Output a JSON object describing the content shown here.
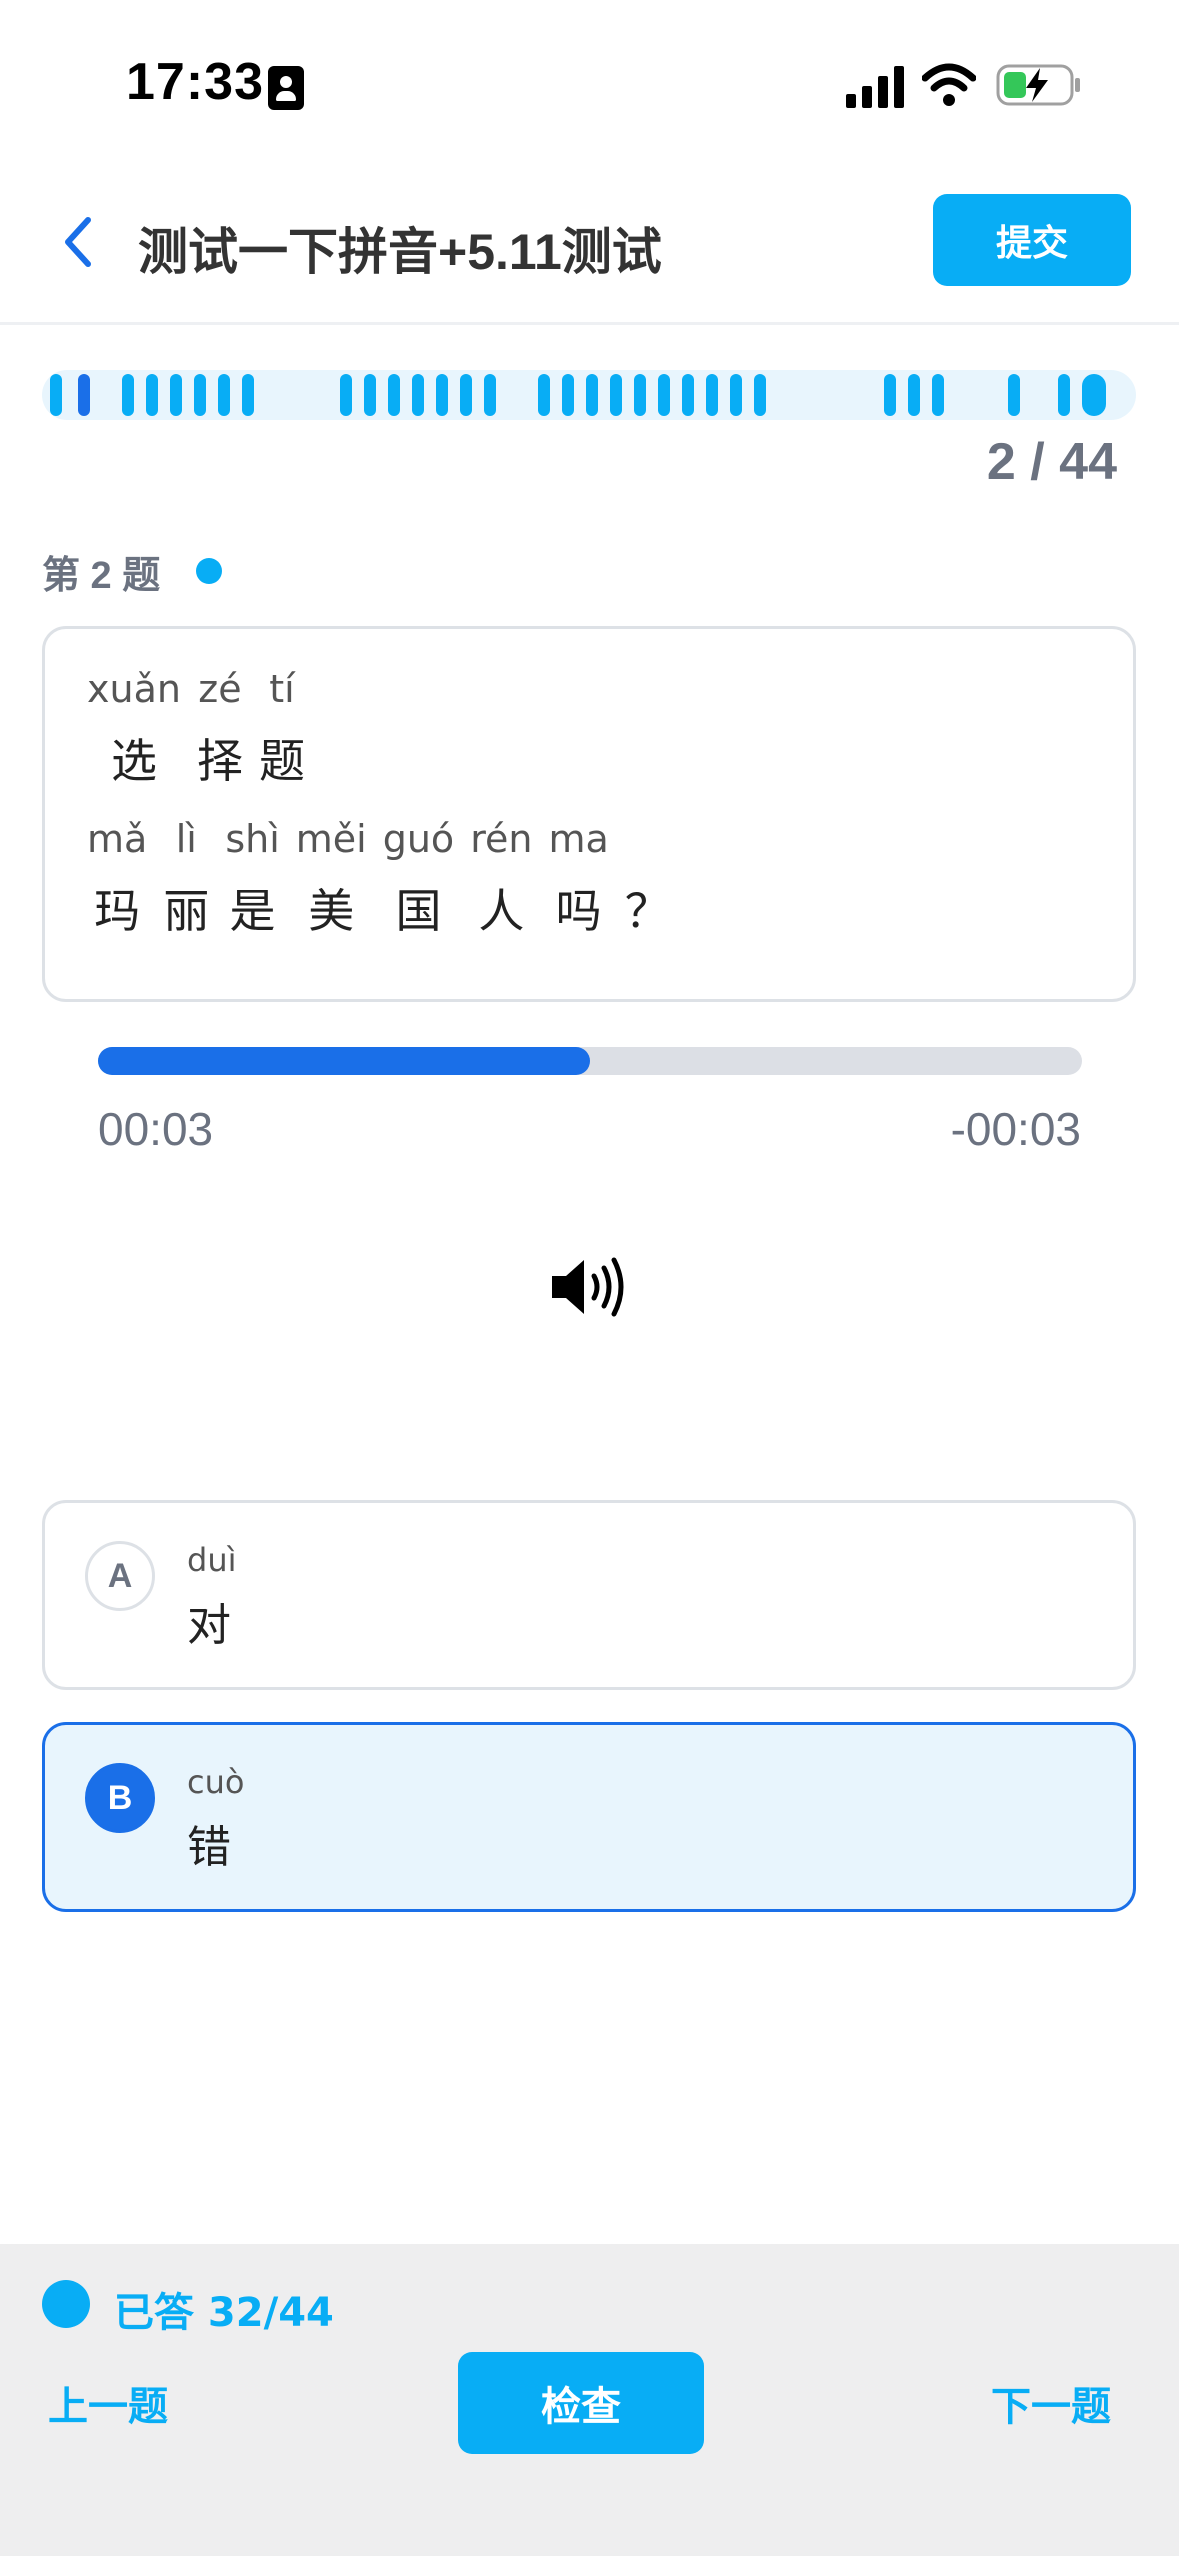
{
  "status_bar": {
    "time": "17:33",
    "icons": [
      "contact-card-icon",
      "cellular-signal-icon",
      "wifi-icon",
      "battery-charging-icon"
    ]
  },
  "header": {
    "title": "测试一下拼音+5.11测试",
    "submit_label": "提交",
    "back_icon": "chevron-left-icon"
  },
  "progress": {
    "counter": "2 / 44",
    "current": 2,
    "total": 44
  },
  "question": {
    "label": "第 2 题",
    "lines": [
      [
        {
          "py": "xuǎn",
          "hz": "选"
        },
        {
          "py": "zé",
          "hz": "择"
        },
        {
          "py": "tí",
          "hz": "题"
        }
      ],
      [
        {
          "py": "mǎ",
          "hz": "玛"
        },
        {
          "py": "lì",
          "hz": "丽"
        },
        {
          "py": "shì",
          "hz": "是"
        },
        {
          "py": "měi",
          "hz": "美"
        },
        {
          "py": "guó",
          "hz": "国"
        },
        {
          "py": "rén",
          "hz": "人"
        },
        {
          "py": "ma",
          "hz": "吗"
        },
        {
          "py": "",
          "hz": "？"
        }
      ]
    ]
  },
  "audio": {
    "elapsed": "00:03",
    "remaining": "-00:03",
    "progress_fraction": 0.5,
    "icon": "speaker-icon"
  },
  "options": [
    {
      "letter": "A",
      "pinyin": "duì",
      "text": "对",
      "selected": false
    },
    {
      "letter": "B",
      "pinyin": "cuò",
      "text": "错",
      "selected": true
    }
  ],
  "footer": {
    "answered": "已答 32/44",
    "prev_label": "上一题",
    "check_label": "检查",
    "next_label": "下一题"
  },
  "colors": {
    "accent": "#08adf5",
    "selected": "#1a6fe8",
    "muted": "#6b7280"
  }
}
